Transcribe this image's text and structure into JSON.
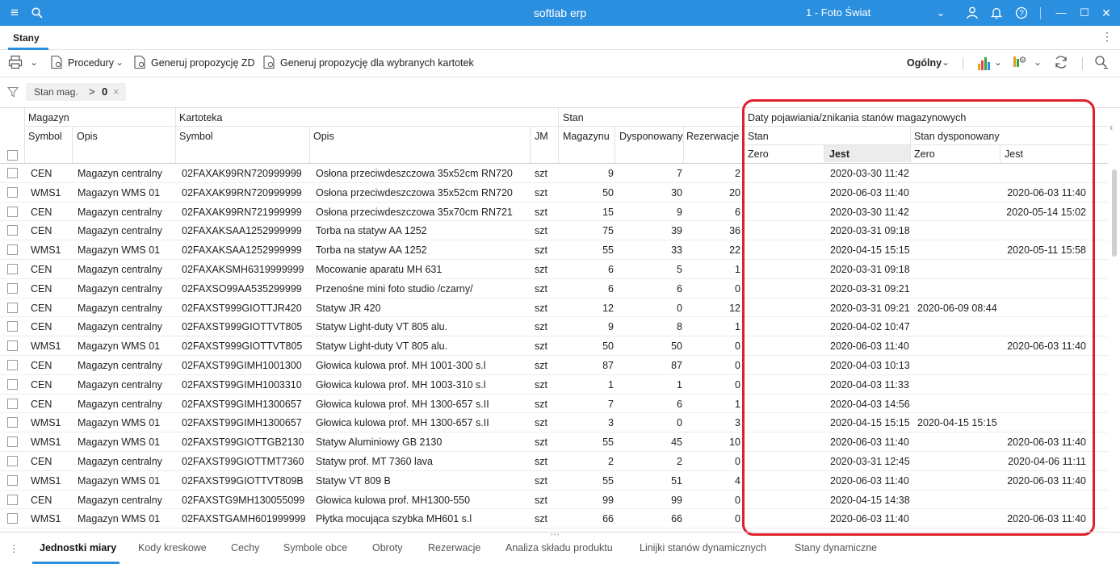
{
  "titlebar": {
    "app_name": "softlab erp",
    "company": "1 - Foto Świat",
    "menu_icon": "hamburger-icon",
    "search_icon": "search-icon",
    "chevron": "⌄",
    "user_icon": "user-icon",
    "bell_icon": "bell-icon",
    "help_icon": "help-icon",
    "minimize": "—",
    "maximize": "☐",
    "close": "✕"
  },
  "tab": {
    "label": "Stany",
    "more": "⋮"
  },
  "toolbar": {
    "print_icon": "printer-icon",
    "procedury": "Procedury",
    "generuj_zd": "Generuj propozycję ZD",
    "generuj_wybrane": "Generuj propozycję dla wybranych kartotek",
    "view": "Ogólny",
    "chart_icon": "bar-chart-icon",
    "settings_icon": "column-settings-icon",
    "refresh_icon": "refresh-icon",
    "search_icon": "search-icon"
  },
  "filter": {
    "field": "Stan mag.",
    "operator": ">",
    "value": "0",
    "remove": "×"
  },
  "headers": {
    "group_magazyn": "Magazyn",
    "group_kartoteka": "Kartoteka",
    "group_stan": "Stan",
    "group_daty": "Daty pojawiania/znikania stanów magazynowych",
    "sub_stan": "Stan",
    "sub_stan_dysp": "Stan dysponowany",
    "symbol": "Symbol",
    "opis": "Opis",
    "k_symbol": "Symbol",
    "k_opis": "Opis",
    "jm": "JM",
    "magazynu": "Magazynu",
    "dysponowany": "Dysponowany",
    "rezerwacje": "Rezerwacje",
    "zero": "Zero",
    "jest": "Jest",
    "zero2": "Zero",
    "jest2": "Jest"
  },
  "rows": [
    {
      "sym": "CEN",
      "opis": "Magazyn centralny",
      "ksym": "02FAXAK99RN720999999",
      "kopis": "Osłona przeciwdeszczowa 35x52cm RN720",
      "jm": "szt",
      "mag": "9",
      "dysp": "7",
      "rez": "2",
      "s_zero": "",
      "s_jest": "2020-03-30 11:42",
      "d_zero": "",
      "d_jest": ""
    },
    {
      "sym": "WMS1",
      "opis": "Magazyn WMS 01",
      "ksym": "02FAXAK99RN720999999",
      "kopis": "Osłona przeciwdeszczowa 35x52cm RN720",
      "jm": "szt",
      "mag": "50",
      "dysp": "30",
      "rez": "20",
      "s_zero": "",
      "s_jest": "2020-06-03 11:40",
      "d_zero": "",
      "d_jest": "2020-06-03 11:40"
    },
    {
      "sym": "CEN",
      "opis": "Magazyn centralny",
      "ksym": "02FAXAK99RN721999999",
      "kopis": "Osłona przeciwdeszczowa 35x70cm RN721",
      "jm": "szt",
      "mag": "15",
      "dysp": "9",
      "rez": "6",
      "s_zero": "",
      "s_jest": "2020-03-30 11:42",
      "d_zero": "",
      "d_jest": "2020-05-14 15:02"
    },
    {
      "sym": "CEN",
      "opis": "Magazyn centralny",
      "ksym": "02FAXAKSAA1252999999",
      "kopis": "Torba na statyw AA 1252",
      "jm": "szt",
      "mag": "75",
      "dysp": "39",
      "rez": "36",
      "s_zero": "",
      "s_jest": "2020-03-31 09:18",
      "d_zero": "",
      "d_jest": ""
    },
    {
      "sym": "WMS1",
      "opis": "Magazyn WMS 01",
      "ksym": "02FAXAKSAA1252999999",
      "kopis": "Torba na statyw AA 1252",
      "jm": "szt",
      "mag": "55",
      "dysp": "33",
      "rez": "22",
      "s_zero": "",
      "s_jest": "2020-04-15 15:15",
      "d_zero": "",
      "d_jest": "2020-05-11 15:58"
    },
    {
      "sym": "CEN",
      "opis": "Magazyn centralny",
      "ksym": "02FAXAKSMH6319999999",
      "kopis": "Mocowanie aparatu MH 631",
      "jm": "szt",
      "mag": "6",
      "dysp": "5",
      "rez": "1",
      "s_zero": "",
      "s_jest": "2020-03-31 09:18",
      "d_zero": "",
      "d_jest": ""
    },
    {
      "sym": "CEN",
      "opis": "Magazyn centralny",
      "ksym": "02FAXSO99AA535299999",
      "kopis": "Przenośne mini foto studio /czarny/",
      "jm": "szt",
      "mag": "6",
      "dysp": "6",
      "rez": "0",
      "s_zero": "",
      "s_jest": "2020-03-31 09:21",
      "d_zero": "",
      "d_jest": ""
    },
    {
      "sym": "CEN",
      "opis": "Magazyn centralny",
      "ksym": "02FAXST999GIOTTJR420",
      "kopis": "Statyw JR 420",
      "jm": "szt",
      "mag": "12",
      "dysp": "0",
      "rez": "12",
      "s_zero": "",
      "s_jest": "2020-03-31 09:21",
      "d_zero": "2020-06-09 08:44",
      "d_jest": ""
    },
    {
      "sym": "CEN",
      "opis": "Magazyn centralny",
      "ksym": "02FAXST999GIOTTVT805",
      "kopis": "Statyw Light-duty VT 805 alu.",
      "jm": "szt",
      "mag": "9",
      "dysp": "8",
      "rez": "1",
      "s_zero": "",
      "s_jest": "2020-04-02 10:47",
      "d_zero": "",
      "d_jest": ""
    },
    {
      "sym": "WMS1",
      "opis": "Magazyn WMS 01",
      "ksym": "02FAXST999GIOTTVT805",
      "kopis": "Statyw Light-duty VT 805 alu.",
      "jm": "szt",
      "mag": "50",
      "dysp": "50",
      "rez": "0",
      "s_zero": "",
      "s_jest": "2020-06-03 11:40",
      "d_zero": "",
      "d_jest": "2020-06-03 11:40"
    },
    {
      "sym": "CEN",
      "opis": "Magazyn centralny",
      "ksym": "02FAXST99GIMH1001300",
      "kopis": "Głowica kulowa prof. MH 1001-300 s.l",
      "jm": "szt",
      "mag": "87",
      "dysp": "87",
      "rez": "0",
      "s_zero": "",
      "s_jest": "2020-04-03 10:13",
      "d_zero": "",
      "d_jest": ""
    },
    {
      "sym": "CEN",
      "opis": "Magazyn centralny",
      "ksym": "02FAXST99GIMH1003310",
      "kopis": "Głowica kulowa prof. MH 1003-310 s.l",
      "jm": "szt",
      "mag": "1",
      "dysp": "1",
      "rez": "0",
      "s_zero": "",
      "s_jest": "2020-04-03 11:33",
      "d_zero": "",
      "d_jest": ""
    },
    {
      "sym": "CEN",
      "opis": "Magazyn centralny",
      "ksym": "02FAXST99GIMH1300657",
      "kopis": "Głowica kulowa prof. MH 1300-657 s.II",
      "jm": "szt",
      "mag": "7",
      "dysp": "6",
      "rez": "1",
      "s_zero": "",
      "s_jest": "2020-04-03 14:56",
      "d_zero": "",
      "d_jest": ""
    },
    {
      "sym": "WMS1",
      "opis": "Magazyn WMS 01",
      "ksym": "02FAXST99GIMH1300657",
      "kopis": "Głowica kulowa prof. MH 1300-657 s.II",
      "jm": "szt",
      "mag": "3",
      "dysp": "0",
      "rez": "3",
      "s_zero": "",
      "s_jest": "2020-04-15 15:15",
      "d_zero": "2020-04-15 15:15",
      "d_jest": ""
    },
    {
      "sym": "WMS1",
      "opis": "Magazyn WMS 01",
      "ksym": "02FAXST99GIOTTGB2130",
      "kopis": "Statyw Aluminiowy GB 2130",
      "jm": "szt",
      "mag": "55",
      "dysp": "45",
      "rez": "10",
      "s_zero": "",
      "s_jest": "2020-06-03 11:40",
      "d_zero": "",
      "d_jest": "2020-06-03 11:40"
    },
    {
      "sym": "CEN",
      "opis": "Magazyn centralny",
      "ksym": "02FAXST99GIOTTMT7360",
      "kopis": "Statyw prof. MT 7360 lava",
      "jm": "szt",
      "mag": "2",
      "dysp": "2",
      "rez": "0",
      "s_zero": "",
      "s_jest": "2020-03-31 12:45",
      "d_zero": "",
      "d_jest": "2020-04-06 11:11"
    },
    {
      "sym": "WMS1",
      "opis": "Magazyn WMS 01",
      "ksym": "02FAXST99GIOTTVT809B",
      "kopis": "Statyw VT 809 B",
      "jm": "szt",
      "mag": "55",
      "dysp": "51",
      "rez": "4",
      "s_zero": "",
      "s_jest": "2020-06-03 11:40",
      "d_zero": "",
      "d_jest": "2020-06-03 11:40"
    },
    {
      "sym": "CEN",
      "opis": "Magazyn centralny",
      "ksym": "02FAXSTG9MH130055099",
      "kopis": "Głowica kulowa prof. MH1300-550",
      "jm": "szt",
      "mag": "99",
      "dysp": "99",
      "rez": "0",
      "s_zero": "",
      "s_jest": "2020-04-15 14:38",
      "d_zero": "",
      "d_jest": ""
    },
    {
      "sym": "WMS1",
      "opis": "Magazyn WMS 01",
      "ksym": "02FAXSTGAMH601999999",
      "kopis": "Płytka mocująca szybka MH601 s.l",
      "jm": "szt",
      "mag": "66",
      "dysp": "66",
      "rez": "0",
      "s_zero": "",
      "s_jest": "2020-06-03 11:40",
      "d_zero": "",
      "d_jest": "2020-06-03 11:40"
    }
  ],
  "bottom_tabs": [
    "Jednostki miary",
    "Kody kreskowe",
    "Cechy",
    "Symbole obce",
    "Obroty",
    "Rezerwacje",
    "Analiza składu produktu",
    "Linijki stanów dynamicznych",
    "Stany dynamiczne"
  ],
  "bottom_more": "⋮",
  "colors": {
    "accent": "#2b8fe0",
    "highlight": "#e0202a"
  }
}
